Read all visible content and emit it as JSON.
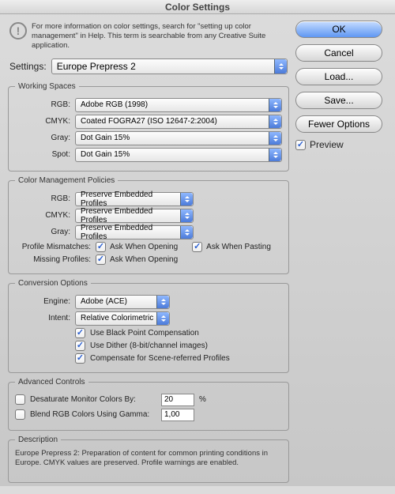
{
  "title": "Color Settings",
  "info_text": "For more information on color settings, search for \"setting up color management\" in Help. This term is searchable from any Creative Suite application.",
  "settings_label": "Settings:",
  "settings_value": "Europe Prepress 2",
  "working_spaces": {
    "legend": "Working Spaces",
    "rgb_label": "RGB:",
    "rgb_value": "Adobe RGB (1998)",
    "cmyk_label": "CMYK:",
    "cmyk_value": "Coated FOGRA27 (ISO 12647-2:2004)",
    "gray_label": "Gray:",
    "gray_value": "Dot Gain 15%",
    "spot_label": "Spot:",
    "spot_value": "Dot Gain 15%"
  },
  "policies": {
    "legend": "Color Management Policies",
    "rgb_label": "RGB:",
    "rgb_value": "Preserve Embedded Profiles",
    "cmyk_label": "CMYK:",
    "cmyk_value": "Preserve Embedded Profiles",
    "gray_label": "Gray:",
    "gray_value": "Preserve Embedded Profiles",
    "mismatch_label": "Profile Mismatches:",
    "mismatch_open": "Ask When Opening",
    "mismatch_paste": "Ask When Pasting",
    "missing_label": "Missing Profiles:",
    "missing_open": "Ask When Opening"
  },
  "conversion": {
    "legend": "Conversion Options",
    "engine_label": "Engine:",
    "engine_value": "Adobe (ACE)",
    "intent_label": "Intent:",
    "intent_value": "Relative Colorimetric",
    "blackpoint": "Use Black Point Compensation",
    "dither": "Use Dither (8-bit/channel images)",
    "scene": "Compensate for Scene-referred Profiles"
  },
  "advanced": {
    "legend": "Advanced Controls",
    "desat": "Desaturate Monitor Colors By:",
    "desat_value": "20",
    "desat_pct": "%",
    "blend": "Blend RGB Colors Using Gamma:",
    "blend_value": "1,00"
  },
  "description": {
    "legend": "Description",
    "text": "Europe Prepress 2:  Preparation of content for common printing conditions in Europe. CMYK values are preserved. Profile warnings are enabled."
  },
  "buttons": {
    "ok": "OK",
    "cancel": "Cancel",
    "load": "Load...",
    "save": "Save...",
    "fewer": "Fewer Options"
  },
  "preview_label": "Preview"
}
